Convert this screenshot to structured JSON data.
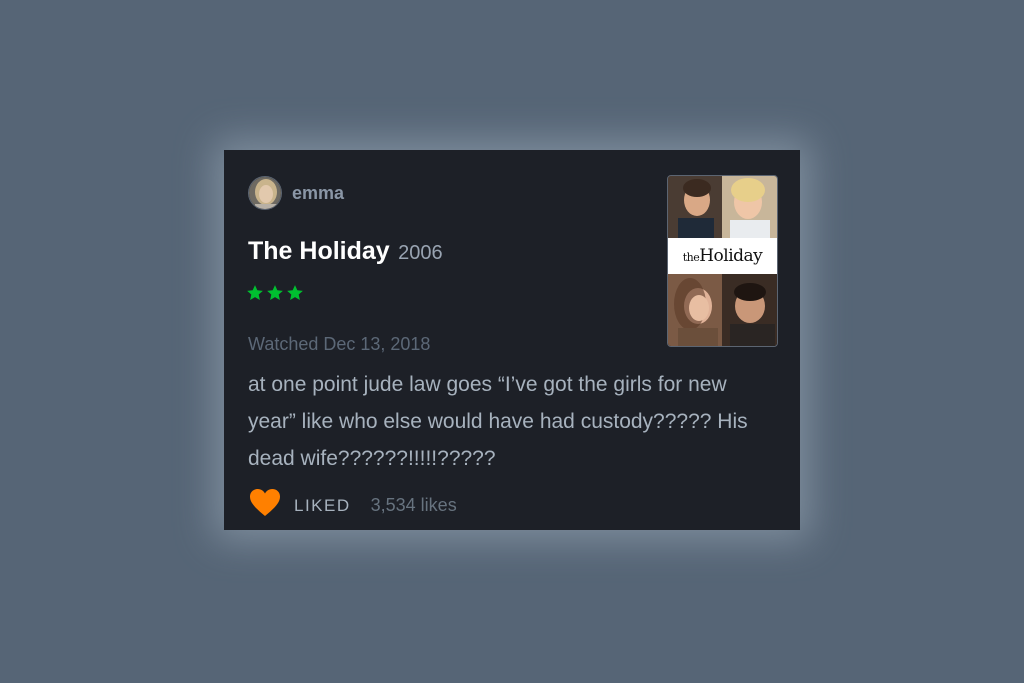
{
  "review": {
    "user": {
      "name": "emma"
    },
    "film": {
      "title": "The Holiday",
      "year": "2006"
    },
    "rating": {
      "stars": 3,
      "max": 5,
      "color": "#00c030"
    },
    "watched": "Watched Dec 13, 2018",
    "text": "at one point jude law goes “I’ve got the girls for new year” like who else would have had custody????? His dead wife??????!!!!!?????",
    "liked_label": "LIKED",
    "likes_count": "3,534 likes",
    "heart_color": "#ff8000"
  },
  "poster": {
    "title_prefix": "the",
    "title_main": "Holiday"
  },
  "icons": {
    "avatar": "user-avatar",
    "star": "star-icon",
    "heart": "heart-icon"
  }
}
